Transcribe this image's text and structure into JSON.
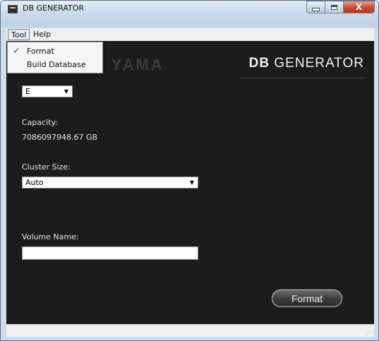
{
  "window": {
    "title": "DB GENERATOR"
  },
  "window_controls": {
    "minimize": "—",
    "maximize": "□",
    "close": "X"
  },
  "menu": {
    "items": [
      "Tool",
      "Help"
    ]
  },
  "tool_menu": {
    "items": [
      {
        "label": "Format",
        "checked": true,
        "check": "✓"
      },
      {
        "label": "Build Database",
        "checked": false
      }
    ]
  },
  "header": {
    "logo_text": "YAMA",
    "brand_bold": "DB",
    "brand_rest": " GENERATOR"
  },
  "drive": {
    "selected": "E"
  },
  "capacity": {
    "label": "Capacity:",
    "value": "7086097948.67 GB"
  },
  "cluster": {
    "label": "Cluster Size:",
    "selected": "Auto"
  },
  "volume": {
    "label": "Volume Name:",
    "value": "",
    "placeholder": ""
  },
  "actions": {
    "format_label": "Format"
  },
  "icons": {
    "app": "app-icon",
    "dropdown": "chevron-down-icon",
    "check": "check-icon",
    "grip": "resize-grip-icon"
  },
  "colors": {
    "content_bg": "#1c1c1c",
    "frame": "#cfdceb",
    "text_light": "#e8e8e8"
  }
}
